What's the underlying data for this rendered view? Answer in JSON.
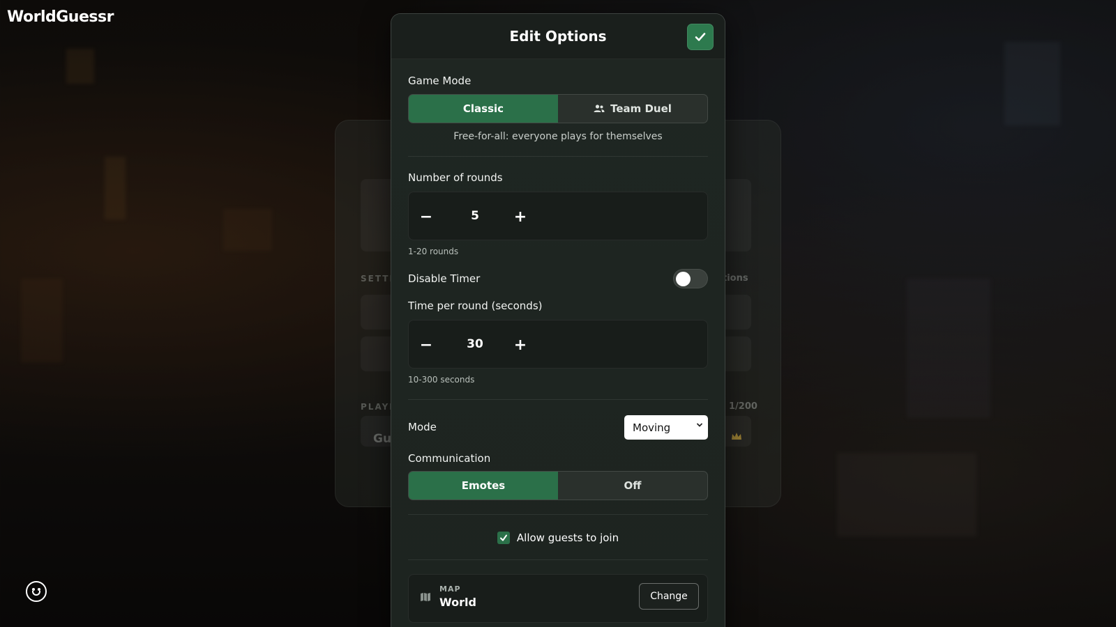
{
  "app": {
    "title": "WorldGuessr"
  },
  "lobby_bg": {
    "settings_label": "SETTI",
    "options_text": "tions",
    "players_label": "PLAYE",
    "player_count": "1/200",
    "player_name_partial": "Gu"
  },
  "modal": {
    "title": "Edit Options",
    "confirm_icon": "check-icon"
  },
  "game_mode": {
    "label": "Game Mode",
    "options": [
      "Classic",
      "Team Duel"
    ],
    "selected": "Classic",
    "description": "Free-for-all: everyone plays for themselves"
  },
  "rounds": {
    "label": "Number of rounds",
    "value": "5",
    "hint": "1-20 rounds",
    "minus": "−",
    "plus": "+"
  },
  "timer": {
    "disable_label": "Disable Timer",
    "disabled": false
  },
  "time_per_round": {
    "label": "Time per round (seconds)",
    "value": "30",
    "hint": "10-300 seconds",
    "minus": "−",
    "plus": "+"
  },
  "mode": {
    "label": "Mode",
    "selected": "Moving"
  },
  "communication": {
    "label": "Communication",
    "options": [
      "Emotes",
      "Off"
    ],
    "selected": "Emotes"
  },
  "guests": {
    "label": "Allow guests to join",
    "checked": true
  },
  "map": {
    "label": "MAP",
    "name": "World",
    "change_label": "Change"
  },
  "colors": {
    "accent": "#2b7049",
    "modal_bg": "#1f2622",
    "stepper_bg": "#181d1a"
  }
}
